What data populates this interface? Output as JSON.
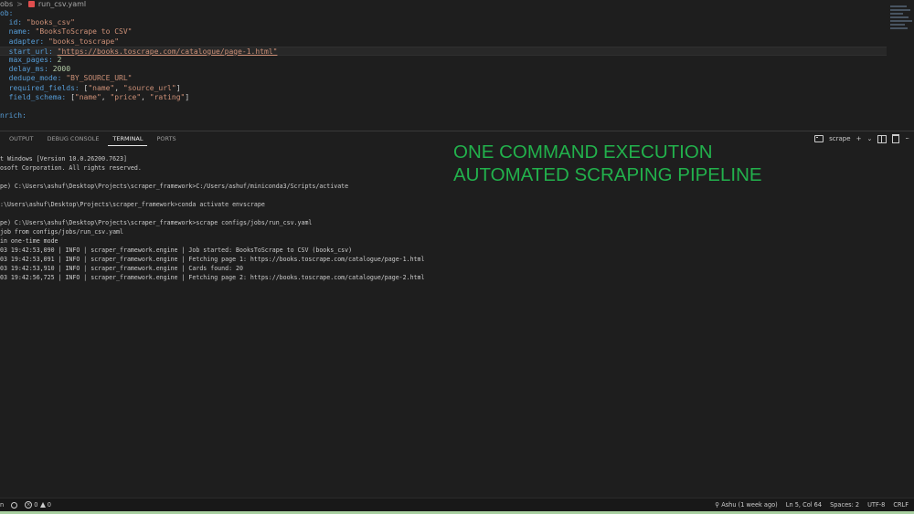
{
  "breadcrumb": {
    "folder": "obs",
    "separator": ">",
    "file": "run_csv.yaml"
  },
  "editor": {
    "lines": [
      [
        {
          "t": "ob:",
          "c": "k"
        }
      ],
      [
        {
          "t": "  id: ",
          "c": "k"
        },
        {
          "t": "\"books_csv\"",
          "c": "s"
        }
      ],
      [
        {
          "t": "  name: ",
          "c": "k"
        },
        {
          "t": "\"BooksToScrape to CSV\"",
          "c": "s"
        }
      ],
      [
        {
          "t": "  adapter: ",
          "c": "k"
        },
        {
          "t": "\"books_toscrape\"",
          "c": "s"
        }
      ],
      [
        {
          "t": "  start_url: ",
          "c": "k"
        },
        {
          "t": "\"https://books.toscrape.com/catalogue/page-1.html\"",
          "c": "s u"
        }
      ],
      [
        {
          "t": "  max_pages: ",
          "c": "k"
        },
        {
          "t": "2",
          "c": "n"
        }
      ],
      [
        {
          "t": "  delay_ms: ",
          "c": "k"
        },
        {
          "t": "2000",
          "c": "n"
        }
      ],
      [
        {
          "t": "  dedupe_mode: ",
          "c": "k"
        },
        {
          "t": "\"BY_SOURCE_URL\"",
          "c": "s"
        }
      ],
      [
        {
          "t": "  required_fields: ",
          "c": "k"
        },
        {
          "t": "[",
          "c": "p"
        },
        {
          "t": "\"name\"",
          "c": "s"
        },
        {
          "t": ", ",
          "c": "p"
        },
        {
          "t": "\"source_url\"",
          "c": "s"
        },
        {
          "t": "]",
          "c": "p"
        }
      ],
      [
        {
          "t": "  field_schema: ",
          "c": "k"
        },
        {
          "t": "[",
          "c": "p"
        },
        {
          "t": "\"name\"",
          "c": "s"
        },
        {
          "t": ", ",
          "c": "p"
        },
        {
          "t": "\"price\"",
          "c": "s"
        },
        {
          "t": ", ",
          "c": "p"
        },
        {
          "t": "\"rating\"",
          "c": "s"
        },
        {
          "t": "]",
          "c": "p"
        }
      ],
      [
        {
          "t": "",
          "c": "p"
        }
      ],
      [
        {
          "t": "nrich:",
          "c": "k"
        }
      ]
    ],
    "current_line": 4
  },
  "panel": {
    "tabs": [
      "OUTPUT",
      "DEBUG CONSOLE",
      "TERMINAL",
      "PORTS"
    ],
    "active_tab": "TERMINAL",
    "terminal_name": "scrape",
    "actions": {
      "add": "+",
      "dropdown": "⌄",
      "more": "···"
    }
  },
  "terminal": {
    "lines": [
      "t Windows [Version 10.0.26200.7623]",
      "osoft Corporation. All rights reserved.",
      "",
      "pe) C:\\Users\\ashuf\\Desktop\\Projects\\scraper_framework>C:/Users/ashuf/miniconda3/Scripts/activate",
      "",
      ":\\Users\\ashuf\\Desktop\\Projects\\scraper_framework>conda activate envscrape",
      "",
      "pe) C:\\Users\\ashuf\\Desktop\\Projects\\scraper_framework>scrape configs/jobs/run_csv.yaml",
      "job from configs/jobs/run_csv.yaml",
      "in one-time mode",
      "03 19:42:53,090 | INFO | scraper_framework.engine | Job started: BooksToScrape to CSV (books_csv)",
      "03 19:42:53,091 | INFO | scraper_framework.engine | Fetching page 1: https://books.toscrape.com/catalogue/page-1.html",
      "03 19:42:53,910 | INFO | scraper_framework.engine | Cards found: 20",
      "03 19:42:56,725 | INFO | scraper_framework.engine | Fetching page 2: https://books.toscrape.com/catalogue/page-2.html"
    ]
  },
  "overlay": {
    "line1": "ONE COMMAND EXECUTION",
    "line2": "AUTOMATED SCRAPING PIPELINE",
    "color": "#22b14c"
  },
  "statusbar": {
    "left_text": "n",
    "problems": "0",
    "warnings": "0",
    "git_blame": "Ashu (1 week ago)",
    "cursor": "Ln 5, Col 64",
    "spaces": "Spaces: 2",
    "encoding": "UTF-8",
    "eol": "CRLF"
  }
}
